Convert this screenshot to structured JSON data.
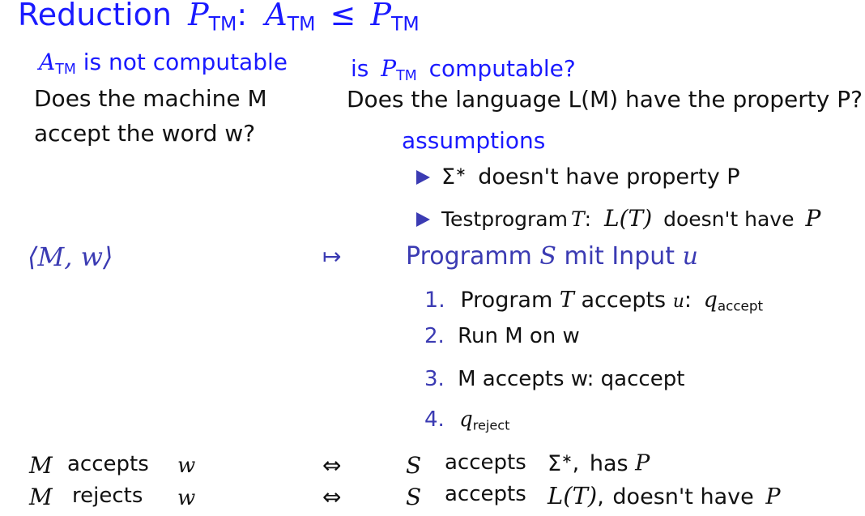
{
  "title": {
    "prefix": "Reduction",
    "p": "P",
    "sub1": "TM",
    "colon": ":",
    "a": "A",
    "sub2": "TM",
    "leq": "≤",
    "p2": "P",
    "sub3": "TM"
  },
  "left_col": {
    "heading_sym": "A",
    "heading_sub": "TM",
    "heading_text": "is not computable",
    "question_line1": "Does the machine M",
    "question_line2": "accept the word w?"
  },
  "right_col": {
    "heading_is": "is",
    "heading_sym": "P",
    "heading_sub": "TM",
    "heading_text": "computable?",
    "question": "Does the language L(M) have the property P?"
  },
  "assumptions": {
    "label": "assumptions",
    "item1_sym": "Σ",
    "item1_sup": "∗",
    "item1_text": "doesn't have property P",
    "item2_pre": "Testprogram",
    "item2_t": "T",
    "item2_colon": ":",
    "item2_lt": "L(T)",
    "item2_text": "doesn't have",
    "item2_p": "P"
  },
  "mapping": {
    "input": "⟨M, w⟩",
    "arrow": "↦",
    "output_pre": "Programm",
    "output_s": "S",
    "output_mid": "mit Input",
    "output_u": "u"
  },
  "steps": [
    {
      "num": "1.",
      "pre": "Program",
      "t": "T",
      "mid": "accepts",
      "u": "u",
      "colon": ":",
      "q": "q",
      "qsub": "accept"
    },
    {
      "num": "2.",
      "text": "Run M on w"
    },
    {
      "num": "3.",
      "text": "M accepts w: qaccept"
    },
    {
      "num": "4.",
      "q": "q",
      "qsub": "reject"
    }
  ],
  "equivalences": [
    {
      "m": "M",
      "verb": "accepts",
      "w": "w",
      "iff": "⇔",
      "s": "S",
      "s_verb": "accepts",
      "lang": "Σ",
      "lang_sup": "∗",
      "comma": ",",
      "result": "has",
      "p": "P"
    },
    {
      "m": "M",
      "verb": "rejects",
      "w": "w",
      "iff": "⇔",
      "s": "S",
      "s_verb": "accepts",
      "lang": "L(T)",
      "comma": ",",
      "result": "doesn't have",
      "p": "P"
    }
  ],
  "colors": {
    "heading_blue": "#1a1aff",
    "slate_blue": "#3b3bb3",
    "text": "#111111"
  }
}
